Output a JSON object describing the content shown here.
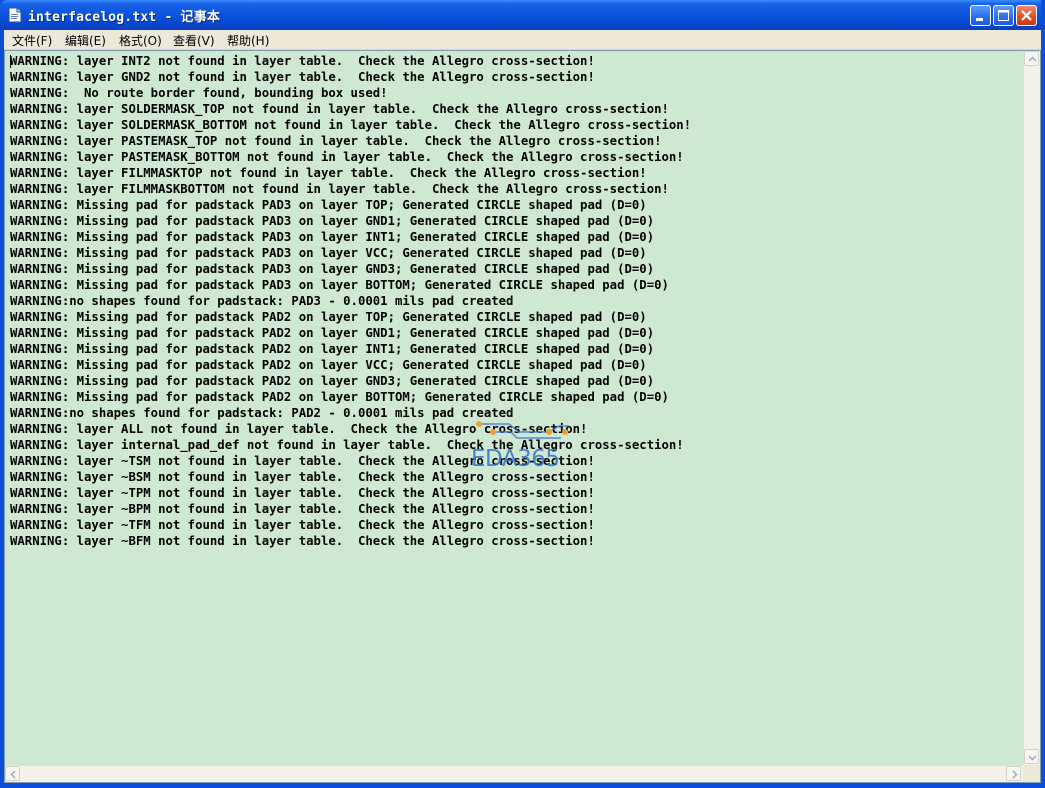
{
  "window": {
    "title": "interfacelog.txt - 记事本"
  },
  "icons": {
    "app": "notepad-document-icon",
    "minimize": "minimize-icon",
    "maximize": "maximize-icon",
    "close": "close-icon",
    "scroll_up": "arrow-up-icon",
    "scroll_down": "arrow-down-icon",
    "scroll_left": "arrow-left-icon",
    "scroll_right": "arrow-right-icon"
  },
  "menu": {
    "file": "文件(F)",
    "edit": "编辑(E)",
    "format": "格式(O)",
    "view": "查看(V)",
    "help": "帮助(H)"
  },
  "editor": {
    "background": "#cfe8d1",
    "content": "WARNING: layer INT2 not found in layer table.  Check the Allegro cross-section!\nWARNING: layer GND2 not found in layer table.  Check the Allegro cross-section!\nWARNING:  No route border found, bounding box used!\nWARNING: layer SOLDERMASK_TOP not found in layer table.  Check the Allegro cross-section!\nWARNING: layer SOLDERMASK_BOTTOM not found in layer table.  Check the Allegro cross-section!\nWARNING: layer PASTEMASK_TOP not found in layer table.  Check the Allegro cross-section!\nWARNING: layer PASTEMASK_BOTTOM not found in layer table.  Check the Allegro cross-section!\nWARNING: layer FILMMASKTOP not found in layer table.  Check the Allegro cross-section!\nWARNING: layer FILMMASKBOTTOM not found in layer table.  Check the Allegro cross-section!\nWARNING: Missing pad for padstack PAD3 on layer TOP; Generated CIRCLE shaped pad (D=0)\nWARNING: Missing pad for padstack PAD3 on layer GND1; Generated CIRCLE shaped pad (D=0)\nWARNING: Missing pad for padstack PAD3 on layer INT1; Generated CIRCLE shaped pad (D=0)\nWARNING: Missing pad for padstack PAD3 on layer VCC; Generated CIRCLE shaped pad (D=0)\nWARNING: Missing pad for padstack PAD3 on layer GND3; Generated CIRCLE shaped pad (D=0)\nWARNING: Missing pad for padstack PAD3 on layer BOTTOM; Generated CIRCLE shaped pad (D=0)\nWARNING:no shapes found for padstack: PAD3 - 0.0001 mils pad created\nWARNING: Missing pad for padstack PAD2 on layer TOP; Generated CIRCLE shaped pad (D=0)\nWARNING: Missing pad for padstack PAD2 on layer GND1; Generated CIRCLE shaped pad (D=0)\nWARNING: Missing pad for padstack PAD2 on layer INT1; Generated CIRCLE shaped pad (D=0)\nWARNING: Missing pad for padstack PAD2 on layer VCC; Generated CIRCLE shaped pad (D=0)\nWARNING: Missing pad for padstack PAD2 on layer GND3; Generated CIRCLE shaped pad (D=0)\nWARNING: Missing pad for padstack PAD2 on layer BOTTOM; Generated CIRCLE shaped pad (D=0)\nWARNING:no shapes found for padstack: PAD2 - 0.0001 mils pad created\nWARNING: layer ALL not found in layer table.  Check the Allegro cross-section!\nWARNING: layer internal_pad_def not found in layer table.  Check the Allegro cross-section!\nWARNING: layer ~TSM not found in layer table.  Check the Allegro cross-section!\nWARNING: layer ~BSM not found in layer table.  Check the Allegro cross-section!\nWARNING: layer ~TPM not found in layer table.  Check the Allegro cross-section!\nWARNING: layer ~BPM not found in layer table.  Check the Allegro cross-section!\nWARNING: layer ~TFM not found in layer table.  Check the Allegro cross-section!\nWARNING: layer ~BFM not found in layer table.  Check the Allegro cross-section!"
  },
  "watermark": {
    "text": "EDA365"
  },
  "colors": {
    "titlebar": "#0b55e0",
    "menubar": "#ece9d8",
    "watermark_blue": "#2f73c9",
    "watermark_orange": "#f0a030"
  }
}
